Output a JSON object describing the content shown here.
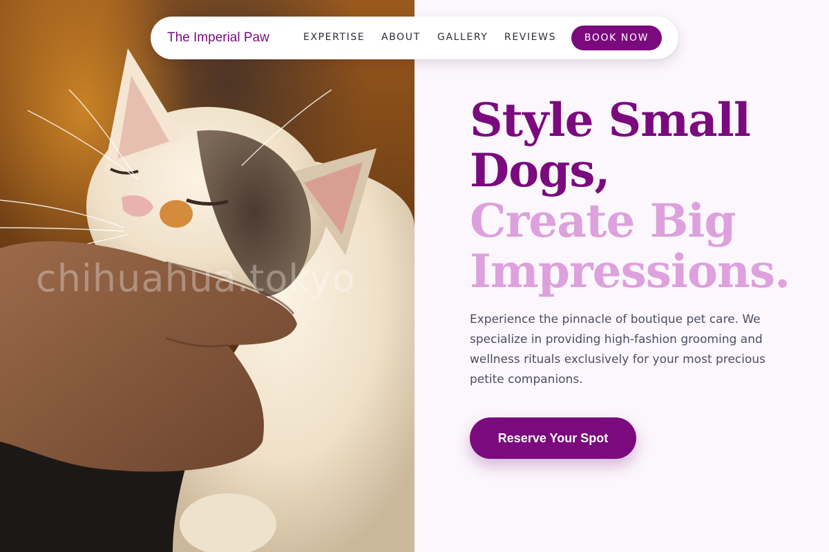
{
  "nav": {
    "brand": "The Imperial Paw",
    "links": [
      "EXPERTISE",
      "ABOUT",
      "GALLERY",
      "REVIEWS"
    ],
    "book_label": "BOOK NOW"
  },
  "hero": {
    "headline_line1": "Style Small",
    "headline_line2": "Dogs,",
    "headline_line3": "Create Big",
    "headline_line4": "Impressions.",
    "lead": "Experience the pinnacle of boutique pet care. We specialize in providing high-fashion grooming and wellness rituals exclusively for your most precious petite companions.",
    "cta_label": "Reserve Your Spot"
  },
  "photo": {
    "watermark": "chihuahua.tokyo",
    "subject": "cat-being-petted-photo"
  },
  "colors": {
    "brand_purple": "#7a0a7e",
    "accent_pink": "#dda1dd",
    "page_background": "#fcf7fc",
    "body_text": "#4a4e63"
  }
}
